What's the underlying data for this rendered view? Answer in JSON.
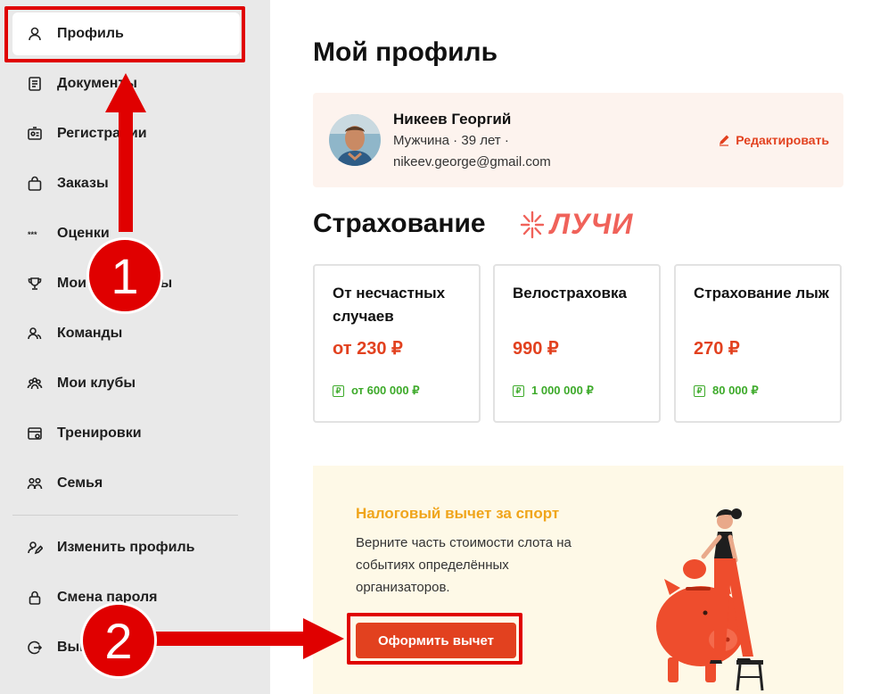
{
  "sidebar": {
    "items": [
      {
        "label": "Профиль",
        "icon": "user-icon"
      },
      {
        "label": "Документы",
        "icon": "document-icon"
      },
      {
        "label": "Регистрации",
        "icon": "badge-icon"
      },
      {
        "label": "Заказы",
        "icon": "bag-icon"
      },
      {
        "label": "Оценки",
        "icon": "stars-icon"
      },
      {
        "label": "Мои результаты",
        "icon": "trophy-icon"
      },
      {
        "label": "Команды",
        "icon": "team-icon"
      },
      {
        "label": "Мои клубы",
        "icon": "clubs-icon"
      },
      {
        "label": "Тренировки",
        "icon": "calendar-icon"
      },
      {
        "label": "Семья",
        "icon": "family-icon"
      }
    ],
    "bottom_items": [
      {
        "label": "Изменить профиль",
        "icon": "edit-profile-icon"
      },
      {
        "label": "Смена пароля",
        "icon": "lock-icon"
      },
      {
        "label": "Выйти",
        "icon": "logout-icon"
      }
    ]
  },
  "main": {
    "title": "Мой профиль",
    "profile": {
      "name": "Никеев Георгий",
      "meta": "Мужчина · 39 лет ·",
      "email": "nikeev.george@gmail.com",
      "edit_label": "Редактировать"
    },
    "insurance": {
      "title": "Страхование",
      "partner": "ЛУЧИ",
      "cards": [
        {
          "name": "От несчастных случаев",
          "price": "от 230 ₽",
          "cover": "от 600 000 ₽"
        },
        {
          "name": "Велостраховка",
          "price": "990 ₽",
          "cover": "1 000 000 ₽"
        },
        {
          "name": "Страхование лыж",
          "price": "270 ₽",
          "cover": "80 000 ₽"
        }
      ]
    },
    "tax": {
      "title": "Налоговый вычет за спорт",
      "description": "Верните часть стоимости слота на событиях определённых организаторов.",
      "button_label": "Оформить вычет"
    }
  },
  "annotations": {
    "step1": "1",
    "step2": "2"
  },
  "colors": {
    "accent": "#e2411f",
    "annotation_red": "#e00000",
    "tax_title": "#f0a51b",
    "cover_green": "#3daa2a",
    "profile_bg": "#fdf3ee",
    "tax_bg": "#fef9e7"
  }
}
